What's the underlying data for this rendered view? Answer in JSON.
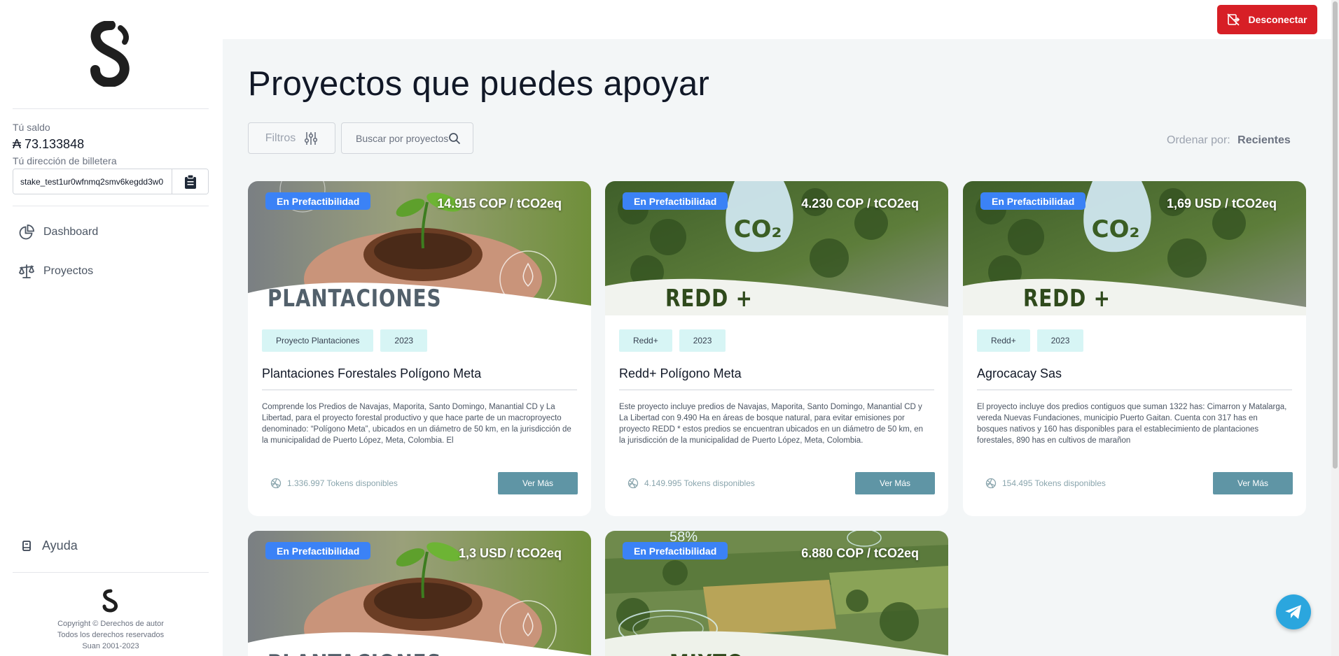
{
  "sidebar": {
    "balance_label": "Tú saldo",
    "balance_value": "₳ 73.133848",
    "wallet_label": "Tú dirección de billetera",
    "wallet_value": "stake_test1ur0wfnmq2smv6kegdd3w0",
    "nav": [
      {
        "label": "Dashboard",
        "icon": "pie-chart-icon"
      },
      {
        "label": "Proyectos",
        "icon": "scale-icon"
      }
    ],
    "help_label": "Ayuda",
    "copyright": [
      "Copyright © Derechos de autor",
      "Todos los derechos reservados",
      "Suan 2001-2023"
    ]
  },
  "topbar": {
    "logout_label": "Desconectar",
    "logout_color": "#d71f26"
  },
  "main": {
    "title": "Proyectos que puedes apoyar",
    "filter_label": "Filtros",
    "search_placeholder": "Buscar por proyectos",
    "sort_label": "Ordenar por:",
    "sort_value": "Recientes"
  },
  "projects": [
    {
      "status": "En Prefactibilidad",
      "price": "14.915 COP / tCO2eq",
      "image_label": "PLANTACIONES",
      "tags": [
        "Proyecto Plantaciones",
        "2023"
      ],
      "title": "Plantaciones Forestales Polígono Meta",
      "description": "Comprende los Predios de Navajas, Maporita, Santo Domingo, Manantial CD y La Libertad, para el proyecto forestal productivo y que hace parte de un macroproyecto denominado: “Polígono Meta”, ubicados en un diámetro de 50 km, en la jurisdicción de la municipalidad de Puerto López, Meta, Colombia. El",
      "tokens": "1.336.997 Tokens disponibles",
      "button": "Ver Más"
    },
    {
      "status": "En Prefactibilidad",
      "price": "4.230 COP / tCO2eq",
      "image_label": "REDD +",
      "tags": [
        "Redd+",
        "2023"
      ],
      "title": "Redd+ Polígono Meta",
      "description": "Este proyecto incluye predios de Navajas, Maporita, Santo Domingo, Manantial CD y La Libertad con 9.490 Ha en áreas de bosque natural, para evitar emisiones por proyecto REDD * estos predios se encuentran ubicados en un diámetro de 50 km, en la jurisdicción de la municipalidad de Puerto López, Meta, Colombia.",
      "tokens": "4.149.995 Tokens disponibles",
      "button": "Ver Más"
    },
    {
      "status": "En Prefactibilidad",
      "price": "1,69 USD / tCO2eq",
      "image_label": "REDD +",
      "tags": [
        "Redd+",
        "2023"
      ],
      "title": "Agrocacay Sas",
      "description": "El proyecto incluye dos predios contiguos que suman 1322 has: Cimarron y Matalarga, vereda Nuevas Fundaciones, municipio Puerto Gaitan. Cuenta con 317 has en bosques nativos y 160 has disponibles para el establecimiento de plantaciones forestales, 890 has en cultivos de marañon",
      "tokens": "154.495 Tokens disponibles",
      "button": "Ver Más"
    },
    {
      "status": "En Prefactibilidad",
      "price": "1,3 USD / tCO2eq",
      "image_label": "PLANTACIONES"
    },
    {
      "status": "En Prefactibilidad",
      "price": "6.880 COP / tCO2eq",
      "image_label": "MIXTO",
      "overlay_text": "58%"
    }
  ]
}
